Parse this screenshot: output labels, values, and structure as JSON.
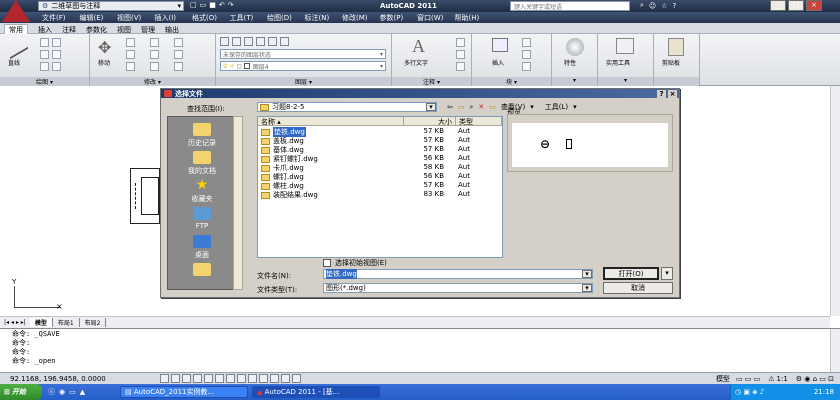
{
  "titlebar": {
    "workspace": "二维草图与注释",
    "title": "AutoCAD 2011",
    "search_placeholder": "键入关键字或短语"
  },
  "menubar": [
    "文件(F)",
    "编辑(E)",
    "视图(V)",
    "插入(I)",
    "格式(O)",
    "工具(T)",
    "绘图(D)",
    "标注(N)",
    "修改(M)",
    "参数(P)",
    "窗口(W)",
    "帮助(H)"
  ],
  "ribbon": {
    "tabs": [
      "常用",
      "插入",
      "注释",
      "参数化",
      "视图",
      "管理",
      "输出"
    ],
    "active_tab": "常用",
    "panels": [
      {
        "label": "绘图",
        "tool": "直线"
      },
      {
        "label": "修改",
        "tool": "移动"
      },
      {
        "label": "图层",
        "layer_state": "未保存的图层状态",
        "layer": "图层4"
      },
      {
        "label": "注释",
        "tool": "多行文字"
      },
      {
        "label": "块",
        "tool": "插入"
      },
      {
        "label": "",
        "tool": "特性"
      },
      {
        "label": "",
        "tool": "实用工具"
      },
      {
        "label": "",
        "tool": "剪贴板"
      }
    ]
  },
  "dialog": {
    "title": "选择文件",
    "lookin_label": "查找范围(I):",
    "lookin_value": "习题8-2-5",
    "view_label": "查看(V)",
    "tools_label": "工具(L)",
    "places": [
      "历史记录",
      "我的文档",
      "收藏夹",
      "FTP",
      "桌面",
      ""
    ],
    "columns": {
      "name": "名称",
      "size": "大小",
      "type": "类型"
    },
    "files": [
      {
        "name": "垫铁.dwg",
        "size": "57 KB",
        "type": "Aut",
        "selected": true
      },
      {
        "name": "盖板.dwg",
        "size": "57 KB",
        "type": "Aut",
        "selected": false
      },
      {
        "name": "基体.dwg",
        "size": "57 KB",
        "type": "Aut",
        "selected": false
      },
      {
        "name": "紧钉螺钉.dwg",
        "size": "56 KB",
        "type": "Aut",
        "selected": false
      },
      {
        "name": "卡爪.dwg",
        "size": "58 KB",
        "type": "Aut",
        "selected": false
      },
      {
        "name": "螺钉.dwg",
        "size": "56 KB",
        "type": "Aut",
        "selected": false
      },
      {
        "name": "螺柱.dwg",
        "size": "57 KB",
        "type": "Aut",
        "selected": false
      },
      {
        "name": "装配结果.dwg",
        "size": "83 KB",
        "type": "Aut",
        "selected": false
      }
    ],
    "preview_label": "预览",
    "initial_view_label": "选择初始视图(E)",
    "filename_label": "文件名(N):",
    "filename_value": "垫铁.dwg",
    "filetype_label": "文件类型(T):",
    "filetype_value": "图形(*.dwg)",
    "open_label": "打开(O)",
    "cancel_label": "取消"
  },
  "layout_tabs": [
    "模型",
    "布局1",
    "布局2"
  ],
  "command_lines": [
    "命令: _QSAVE",
    "命令:",
    "命令:",
    "命令: _open"
  ],
  "status": {
    "coords": "92.1168, 196.9458, 0.0000",
    "model_label": "模型",
    "scale": "1:1"
  },
  "taskbar": {
    "start": "开始",
    "tasks": [
      "AutoCAD_2011实例教...",
      "AutoCAD 2011 - [基..."
    ],
    "time": "21:18"
  }
}
